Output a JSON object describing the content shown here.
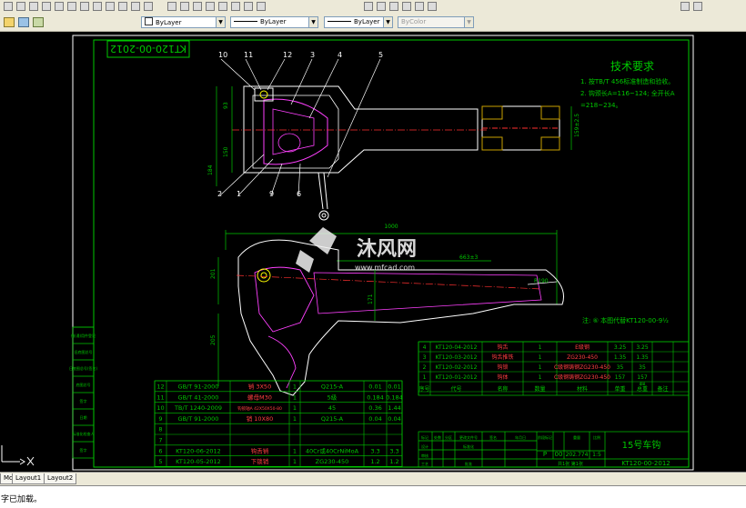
{
  "toolbar": {
    "icons": [
      "new",
      "open",
      "save",
      "plot",
      "preview",
      "cut",
      "copy",
      "paste",
      "match",
      "undo",
      "redo",
      "pan",
      "zoom",
      "properties",
      "design-center",
      "tool-palettes",
      "layer",
      "layer-previous",
      "block",
      "insert",
      "line",
      "circle",
      "arc",
      "hatch",
      "text",
      "dimension",
      "zoom-window",
      "zoom-previous"
    ]
  },
  "properties_bar": {
    "layer_value": "ByLayer",
    "linetype_value": "ByLayer",
    "lineweight_value": "ByLayer",
    "plotstyle_value": "ByColor"
  },
  "drawing": {
    "drawing_number_rotated": "KT120-00-2012",
    "tech_title": "技术要求",
    "tech_line1": "1. 按TB/T 456标准制造和验收。",
    "tech_line2": "2. 钩颈长A=116~124; 全开长A",
    "tech_line3": "=218~234。",
    "note": "注: ⑥ 本图代替KT120-00-9½",
    "balloons": [
      "10",
      "11",
      "12",
      "3",
      "4",
      "5",
      "2",
      "1",
      "9",
      "6"
    ],
    "dims": {
      "top_width": "1000",
      "inner_len": "663±3",
      "d_right": "159±2.5",
      "h_201": "201",
      "h_205": "205",
      "h_171": "171",
      "h_93": "93",
      "h_150": "150",
      "h_184": "184",
      "r_radius": "R190"
    },
    "watermark_title": "沐风网",
    "watermark_url": "www.mfcad.com",
    "left_strip": [
      "借(通)用件登记",
      "旧底图总号",
      "日底图总号(签名)",
      "底图总号",
      "签字",
      "日期",
      "标准化检查人",
      "签字"
    ],
    "upper_bom": [
      [
        "4",
        "KT120-04-2012",
        "钩舌",
        "1",
        "E级钢",
        "3.25",
        "3.25",
        ""
      ],
      [
        "3",
        "KT120-03-2012",
        "钩舌推铁",
        "1",
        "ZG230-450",
        "1.35",
        "1.35",
        ""
      ],
      [
        "2",
        "KT120-02-2012",
        "钩锁",
        "1",
        "C级钢铸钢ZG230-450",
        "35",
        "35",
        ""
      ],
      [
        "1",
        "KT120-01-2012",
        "钩体",
        "1",
        "C级钢铸钢ZG230-450",
        "157",
        "157",
        ""
      ]
    ],
    "upper_bom_header": [
      "序号",
      "代号",
      "名称",
      "数量",
      "材料",
      "单重",
      "总重",
      "备注"
    ],
    "upper_bom_header_sub": "重量",
    "lower_bom": [
      [
        "12",
        "GB/T 91-2000",
        "销 3X50",
        "1",
        "Q215-A",
        "0.01",
        "0.01"
      ],
      [
        "11",
        "GB/T 41-2000",
        "螺母M30",
        "1",
        "5级",
        "0.184",
        "0.184"
      ],
      [
        "10",
        "TB/T 1240-2009",
        "钩锁轴A 42X50X50-80",
        "1",
        "45",
        "0.36",
        "1.44"
      ],
      [
        "9",
        "GB/T 91-2000",
        "销 10X80",
        "1",
        "Q215-A",
        "0.04",
        "0.04"
      ],
      [
        "8",
        "",
        "",
        "",
        "",
        "",
        ""
      ],
      [
        "7",
        "",
        "",
        "",
        "",
        "",
        ""
      ],
      [
        "6",
        "KT120-06-2012",
        "钩舌销",
        "1",
        "40Cr或40CrNiMoA",
        "3.3",
        "3.3"
      ],
      [
        "5",
        "KT120-05-2012",
        "下锁销",
        "1",
        "ZG230-450",
        "1.2",
        "1.2"
      ]
    ],
    "title_block": {
      "name": "15号车钩",
      "number": "KT120-00-2012",
      "stage": "P",
      "mark": "00",
      "weight": "202.774",
      "scale": "1:5",
      "sheets": "共1张 第1张",
      "labels": [
        "标记",
        "处数",
        "分区",
        "更改文件号",
        "签名",
        "年月日",
        "设计",
        "标准化",
        "审核",
        "工艺",
        "批准",
        "阶段标记",
        "重量",
        "比例"
      ]
    }
  },
  "tabs": [
    "Model",
    "Layout1",
    "Layout2"
  ],
  "command_line": "字已加载。"
}
